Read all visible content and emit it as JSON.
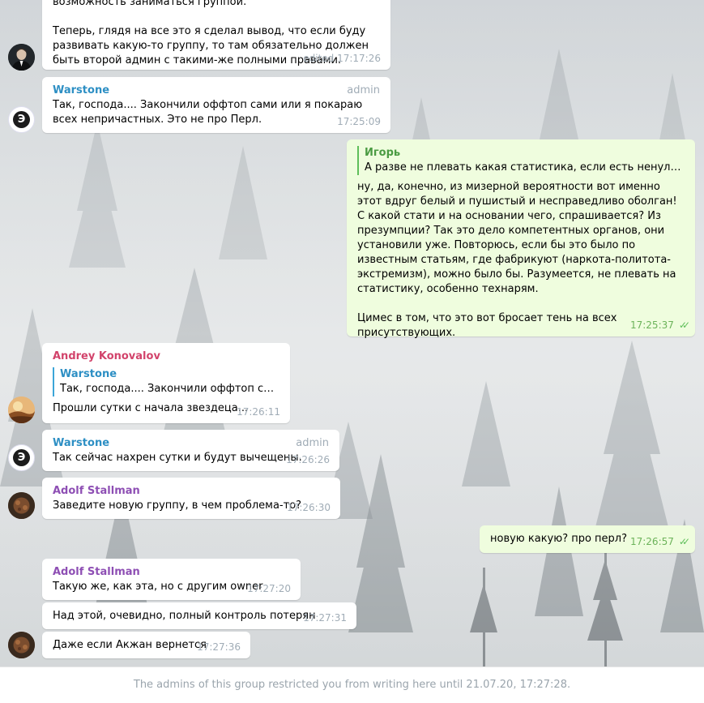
{
  "colors": {
    "incoming_bubble": "#ffffff",
    "outgoing_bubble": "#effdde",
    "name_warstone": "#2d8fc4",
    "name_igor": "#4a9b42",
    "name_andrey": "#d2436b",
    "name_adolf": "#8e4fb4",
    "meta_gray": "#a0acb6",
    "out_time_green": "#6cb35a"
  },
  "messages": [
    {
      "text": "возможность заниматься группой.\n\nТеперь, глядя на все это я сделал вывод, что если буду развивать какую-то группу, то там обязательно должен быть второй админ с такими-же полными правами.",
      "time": "edited 17:17:26"
    },
    {
      "sender": "Warstone",
      "badge": "admin",
      "text": "Так, господа.... Закончили оффтоп сами или я покараю всех непричастных. Это не про Перл.",
      "time": "17:25:09"
    },
    {
      "reply_name": "Игорь",
      "reply_text": "А разве не плевать какая статистика, если есть ненулевая в...",
      "text": "ну, да, конечно, из мизерной вероятности вот именно этот вдруг белый и пушистый и несправедливо оболган! С какой стати и на основании чего, спрашивается? Из презумпции? Так это дело компетентных органов, они установили уже. Повторюсь, если бы это было по известным статьям, где фабрикуют (наркота-политота-экстремизм), можно было бы. Разумеется, не плевать на статистику, особенно технарям.\n\nЦимес в том, что это вот бросает тень на всех присутствующих.",
      "time": "17:25:37",
      "checks": "✓✓"
    },
    {
      "sender": "Andrey Konovalov",
      "reply_name": "Warstone",
      "reply_text": "Так, господа.... Закончили оффтоп сами ...",
      "text": "Прошли сутки с начала звездеца...",
      "time": "17:26:11"
    },
    {
      "sender": "Warstone",
      "badge": "admin",
      "text": "Так сейчас нахрен сутки и будут вычещены.",
      "time": "17:26:26"
    },
    {
      "sender": "Adolf Stallman",
      "text": "Заведите новую группу, в чем проблема-то?",
      "time": "17:26:30"
    },
    {
      "text": "новую какую? про перл?",
      "time": "17:26:57",
      "checks": "✓✓"
    },
    {
      "sender": "Adolf Stallman",
      "text": "Такую же, как эта, но с другим owner",
      "time": "17:27:20"
    },
    {
      "text": "Над этой, очевидно, полный контроль потерян",
      "time": "17:27:31"
    },
    {
      "text": "Даже если Акжан вернется",
      "time": "17:27:36"
    }
  ],
  "footer": {
    "restriction_text": "The admins of this group restricted you from writing here until 21.07.20, 17:27:28."
  },
  "avatar_glyph": "Э"
}
